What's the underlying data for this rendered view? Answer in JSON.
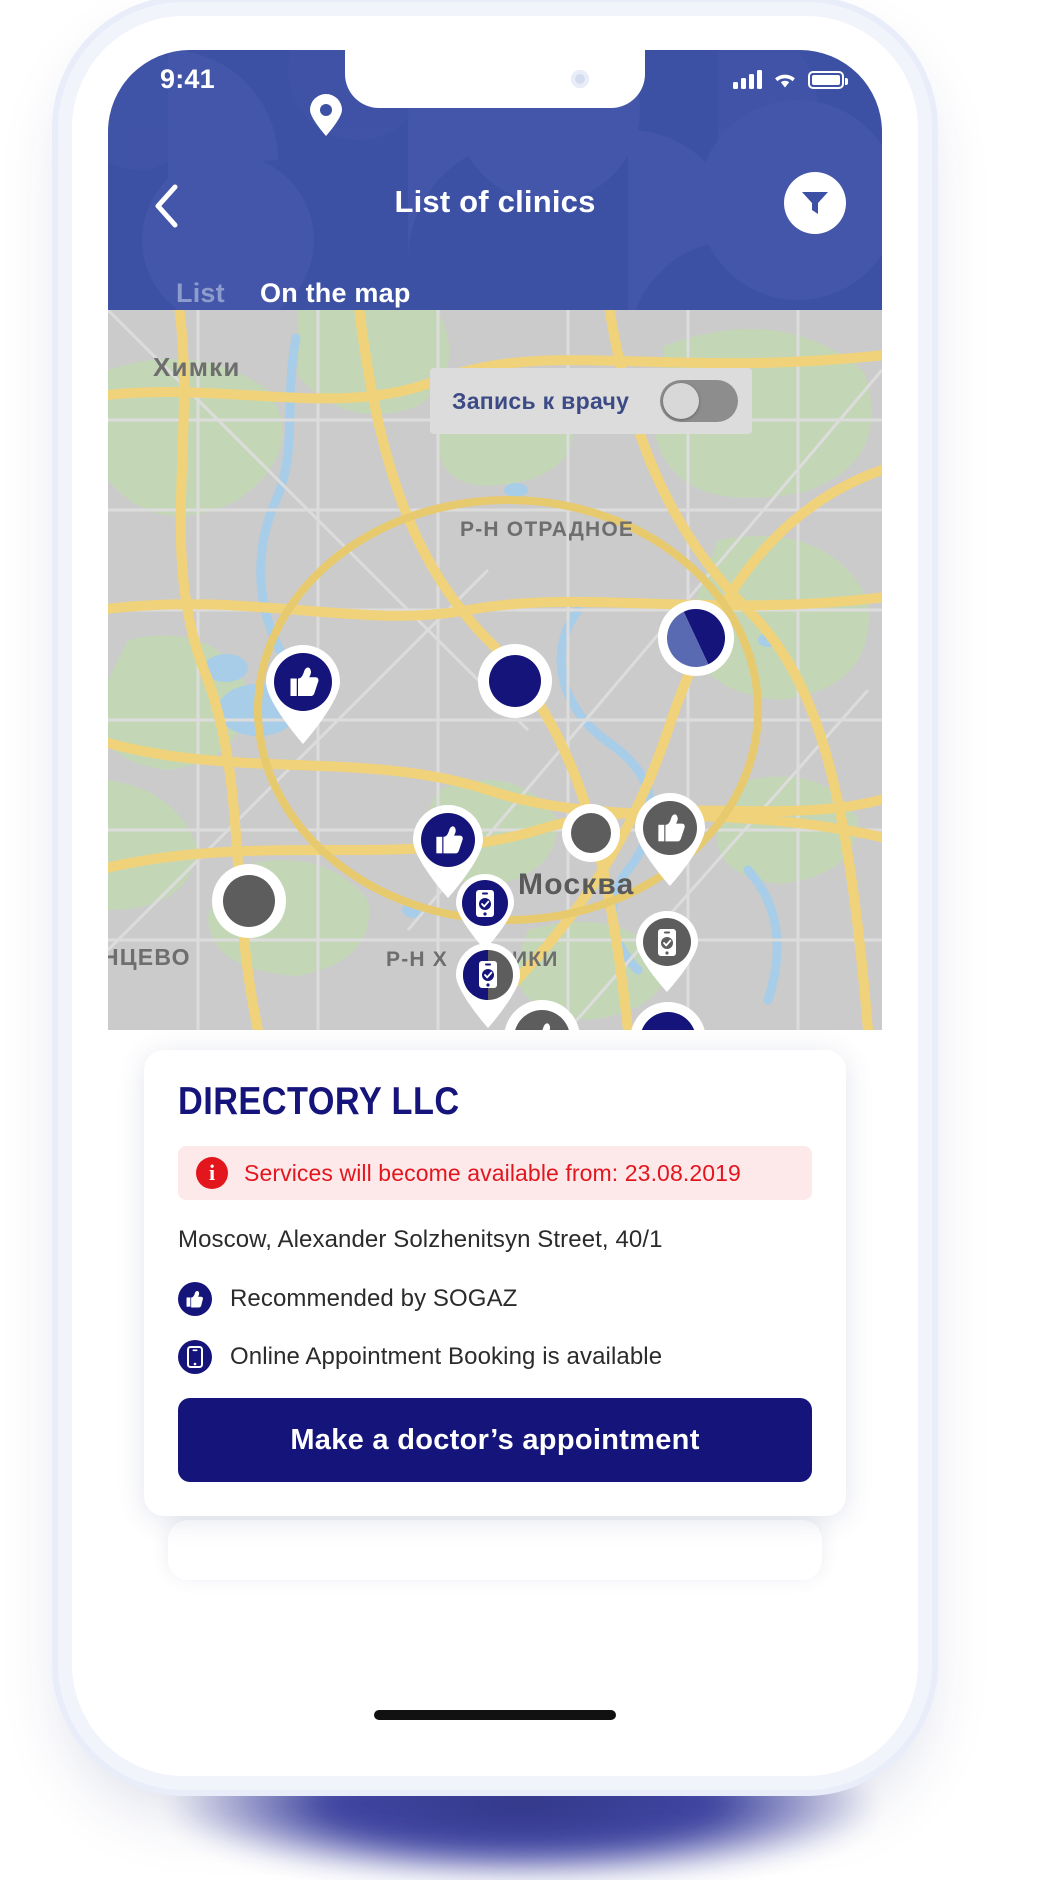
{
  "status_bar": {
    "time": "9:41",
    "signal_icon": "cellular-bars-icon",
    "wifi_icon": "wifi-icon",
    "battery_icon": "battery-full-icon"
  },
  "header": {
    "title": "List of clinics",
    "back_icon": "chevron-left-icon",
    "filter_icon": "filter-funnel-icon",
    "bg_color": "#3c50a4"
  },
  "tabs": [
    {
      "label": "List",
      "active": false
    },
    {
      "label": "On the map",
      "active": true
    }
  ],
  "map": {
    "toggle": {
      "label": "Запись к врачу",
      "state": "off"
    },
    "labels": [
      {
        "text": "Химки"
      },
      {
        "text": "Р-Н ОТРАДНОЕ"
      },
      {
        "text": "Москва"
      },
      {
        "text": "НЦЕВО"
      },
      {
        "text": "Р-Н Х"
      },
      {
        "text": "ИКИ"
      }
    ],
    "pin_legend": {
      "thumbs_up": "thumbs-up-icon",
      "online_booking": "phone-check-icon",
      "plain": "circle-icon"
    }
  },
  "clinic_card": {
    "title": "DIRECTORY LLC",
    "alert": {
      "icon": "info-icon",
      "text": "Services will become available from: 23.08.2019",
      "color": "#e3161e",
      "bg_color": "#fde8ea"
    },
    "address": "Moscow, Alexander Solzhenitsyn Street, 40/1",
    "features": [
      {
        "icon": "thumbs-up-icon",
        "text": "Recommended by SOGAZ"
      },
      {
        "icon": "phone-icon",
        "text": "Online Appointment Booking is available"
      }
    ],
    "cta_label": "Make a doctor’s appointment",
    "cta_color": "#15147a",
    "title_color": "#15147a"
  }
}
